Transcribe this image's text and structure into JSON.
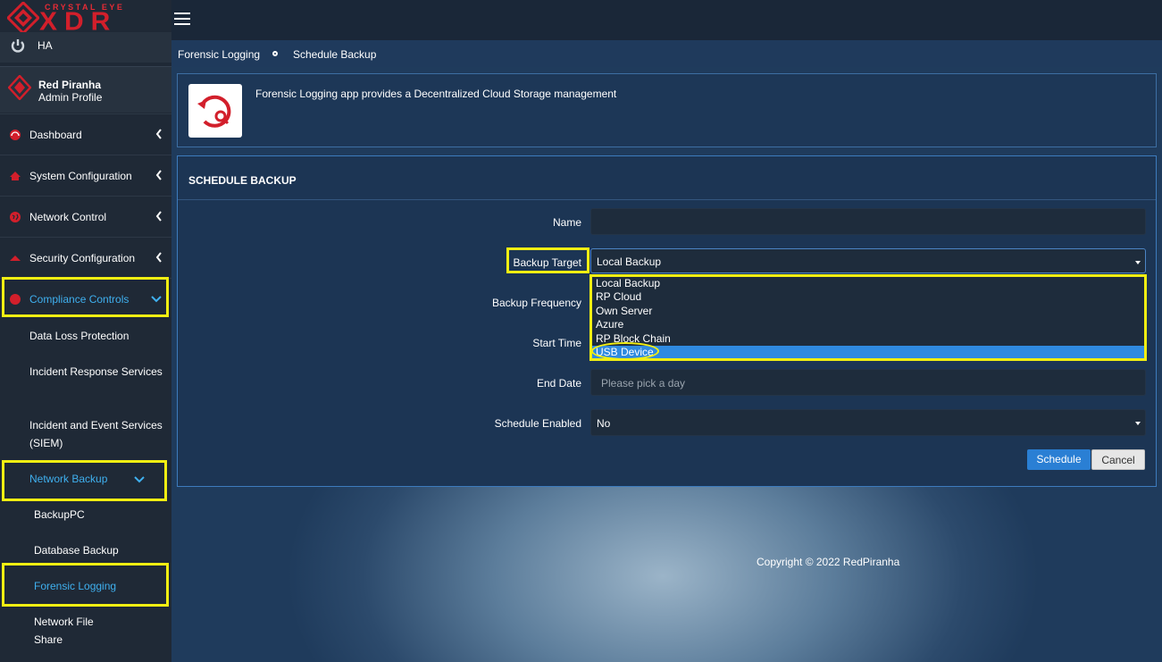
{
  "brand": {
    "top": "CRYSTAL EYE",
    "main": "XDR",
    "accent": "#d21f2b"
  },
  "sidebar": {
    "ha_label": "HA",
    "profile_name": "Red Piranha",
    "profile_sub": "Admin Profile",
    "nav": [
      {
        "label": "Dashboard",
        "icon": "dashboard-icon"
      },
      {
        "label": "System Configuration",
        "icon": "home-icon"
      },
      {
        "label": "Network Control",
        "icon": "globe-icon"
      },
      {
        "label": "Security Configuration",
        "icon": "shield-icon"
      },
      {
        "label": "Compliance Controls",
        "icon": "compliance-icon"
      }
    ],
    "compliance_sub": [
      "Data Loss Protection",
      "Incident Response Services",
      "Incident and Event Services (SIEM)"
    ],
    "network_backup_label": "Network Backup",
    "network_backup_sub": [
      "BackupPC",
      "Database Backup",
      "Forensic Logging",
      "Network File Share"
    ],
    "active_color": "#3fb0ef",
    "highlight_color": "#f1ee12"
  },
  "breadcrumb": {
    "parent": "Forensic Logging",
    "current": "Schedule Backup"
  },
  "app_panel": {
    "description": "Forensic Logging app provides a Decentralized Cloud Storage management"
  },
  "form": {
    "title": "SCHEDULE BACKUP",
    "name_label": "Name",
    "name_value": "",
    "backup_target_label": "Backup Target",
    "backup_target_value": "Local Backup",
    "backup_target_options": [
      "Local Backup",
      "RP Cloud",
      "Own Server",
      "Azure",
      "RP Block Chain",
      "USB Device"
    ],
    "backup_target_highlighted": "USB Device",
    "backup_frequency_label": "Backup Frequency",
    "start_time_label": "Start Time",
    "end_date_label": "End Date",
    "end_date_placeholder": "Please pick a day",
    "schedule_enabled_label": "Schedule Enabled",
    "schedule_enabled_value": "No",
    "schedule_button": "Schedule",
    "cancel_button": "Cancel"
  },
  "footer": {
    "copyright": "Copyright © 2022 RedPiranha"
  }
}
